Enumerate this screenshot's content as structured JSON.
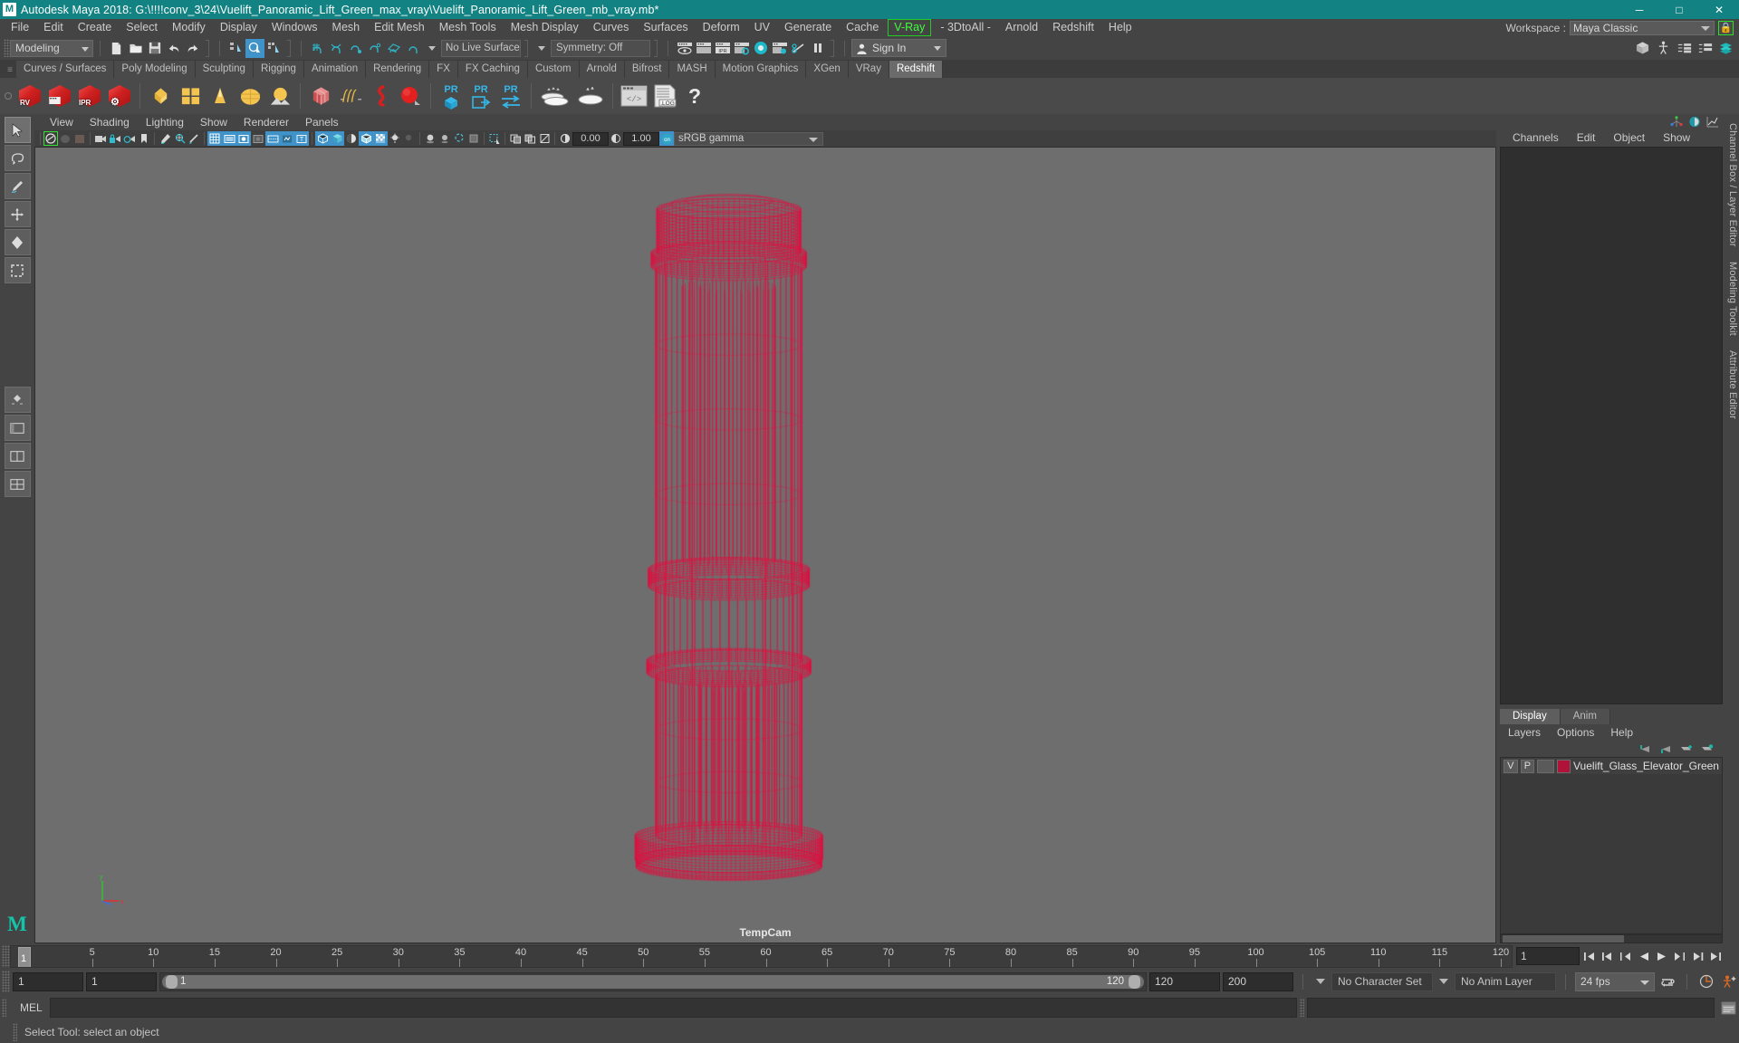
{
  "titlebar": {
    "logo": "M",
    "title": "Autodesk Maya 2018: G:\\!!!!conv_3\\24\\Vuelift_Panoramic_Lift_Green_max_vray\\Vuelift_Panoramic_Lift_Green_mb_vray.mb*",
    "minimize": "─",
    "maximize": "□",
    "close": "✕",
    "bg_color": "#128282"
  },
  "menubar": {
    "items": [
      {
        "label": "File"
      },
      {
        "label": "Edit"
      },
      {
        "label": "Create"
      },
      {
        "label": "Select"
      },
      {
        "label": "Modify"
      },
      {
        "label": "Display"
      },
      {
        "label": "Windows"
      },
      {
        "label": "Mesh"
      },
      {
        "label": "Edit Mesh"
      },
      {
        "label": "Mesh Tools"
      },
      {
        "label": "Mesh Display"
      },
      {
        "label": "Curves"
      },
      {
        "label": "Surfaces"
      },
      {
        "label": "Deform"
      },
      {
        "label": "UV"
      },
      {
        "label": "Generate"
      },
      {
        "label": "Cache"
      },
      {
        "label": "V-Ray",
        "highlight": true
      },
      {
        "label": "- 3DtoAll -"
      },
      {
        "label": "Arnold"
      },
      {
        "label": "Redshift"
      },
      {
        "label": "Help"
      }
    ],
    "workspace_label": "Workspace :",
    "workspace_value": "Maya Classic",
    "lock_icon": "lock-icon",
    "highlight_color": "#3dff3d"
  },
  "statusbar": {
    "mode_menu": "Modeling",
    "no_live_surface": "No Live Surface",
    "symmetry": "Symmetry: Off",
    "sign_in": "Sign In",
    "file_icons": [
      "new-scene-icon",
      "open-scene-icon",
      "save-scene-icon",
      "undo-icon",
      "redo-icon"
    ],
    "select_mode_icons": [
      "select-by-hierarchy-icon",
      "select-by-object-icon",
      "select-by-component-icon"
    ],
    "snap_icons": [
      "snap-to-grid-icon",
      "snap-to-curve-icon",
      "snap-to-point-icon",
      "snap-to-projected-center-icon",
      "snap-to-view-plane-icon",
      "make-live-icon"
    ],
    "render_icons": [
      "render-view-icon",
      "render-sequence-icon",
      "ipr-render-icon",
      "render-settings-icon",
      "hypershade-icon",
      "render-setup-icon",
      "rendering-flags-icon",
      "pause-icon"
    ],
    "right_icons": [
      "show-hide-modeling-toolkit-icon",
      "show-hide-character-controls-icon",
      "show-hide-attribute-editor-icon",
      "show-hide-tool-settings-icon",
      "show-hide-channel-box-icon"
    ]
  },
  "shelf": {
    "tabs": [
      {
        "label": "Curves / Surfaces"
      },
      {
        "label": "Poly Modeling"
      },
      {
        "label": "Sculpting"
      },
      {
        "label": "Rigging"
      },
      {
        "label": "Animation"
      },
      {
        "label": "Rendering"
      },
      {
        "label": "FX"
      },
      {
        "label": "FX Caching"
      },
      {
        "label": "Custom"
      },
      {
        "label": "Arnold"
      },
      {
        "label": "Bifrost"
      },
      {
        "label": "MASH"
      },
      {
        "label": "Motion Graphics"
      },
      {
        "label": "XGen"
      },
      {
        "label": "VRay"
      },
      {
        "label": "Redshift",
        "active": true
      }
    ],
    "buttons": [
      {
        "name": "redshift-render-view-icon",
        "badge": "RV"
      },
      {
        "name": "redshift-render-sequence-icon",
        "badge": ""
      },
      {
        "name": "redshift-ipr-icon",
        "badge": "IPR"
      },
      {
        "name": "redshift-render-settings-icon",
        "badge": ""
      },
      {
        "name": "redshift-material-icon",
        "badge": ""
      },
      {
        "name": "redshift-material-blender-icon",
        "badge": ""
      },
      {
        "name": "redshift-sss-icon",
        "badge": ""
      },
      {
        "name": "redshift-dome-light-icon",
        "badge": ""
      },
      {
        "name": "redshift-environment-icon",
        "badge": ""
      },
      {
        "name": "redshift-proxy-icon",
        "badge": ""
      },
      {
        "name": "redshift-hair-icon",
        "badge": ""
      },
      {
        "name": "redshift-volume-icon",
        "badge": ""
      },
      {
        "name": "redshift-sprite-icon",
        "badge": ""
      },
      {
        "name": "redshift-pr-object-icon",
        "badge": "PR"
      },
      {
        "name": "redshift-pr-export-icon",
        "badge": "PR"
      },
      {
        "name": "redshift-pr-transfer-icon",
        "badge": "PR"
      },
      {
        "name": "redshift-bake-icon",
        "badge": ""
      },
      {
        "name": "redshift-bake-set-icon",
        "badge": ""
      },
      {
        "name": "redshift-script-editor-icon",
        "badge": ""
      },
      {
        "name": "redshift-log-icon",
        "badge": ""
      },
      {
        "name": "redshift-help-icon",
        "badge": "?"
      }
    ]
  },
  "toolbox": {
    "items": [
      {
        "name": "select-tool",
        "glyph": "➤",
        "selected": true
      },
      {
        "name": "lasso-select-tool",
        "glyph": "❂"
      },
      {
        "name": "paint-select-tool",
        "glyph": "✎"
      },
      {
        "name": "move-tool",
        "glyph": "✥"
      },
      {
        "name": "rotate-tool",
        "glyph": "◆"
      },
      {
        "name": "scale-tool",
        "glyph": "▣"
      },
      {
        "name": "last-tool-used",
        "glyph": "◈"
      },
      {
        "name": "layout-single-pane",
        "glyph": "⊞"
      },
      {
        "name": "layout-two-pane",
        "glyph": "⬚"
      },
      {
        "name": "layout-four-pane",
        "glyph": "☷"
      }
    ],
    "logo": "M"
  },
  "viewport": {
    "menus": [
      {
        "label": "View"
      },
      {
        "label": "Shading"
      },
      {
        "label": "Lighting"
      },
      {
        "label": "Show"
      },
      {
        "label": "Renderer"
      },
      {
        "label": "Panels"
      }
    ],
    "exposure_value": "0.00",
    "gamma_value": "1.00",
    "color_profile": "sRGB gamma",
    "camera_label": "TempCam",
    "background_color": "#6e6e6e",
    "wireframe_color": "#e01040",
    "axis_labels": {
      "y": "y",
      "x": "x",
      "z": "z"
    },
    "toolbar_icons": [
      "select-camera-icon",
      "lock-camera-icon",
      "camera-attributes-icon",
      "bookmark-icon",
      "image-plane-icon",
      "two-d-pan-zoom-icon",
      "grease-pencil-icon",
      "grid-toggle-icon",
      "film-gate-icon",
      "resolution-gate-icon",
      "gate-mask-icon",
      "film-origin-icon",
      "safe-action-icon",
      "title-safe-icon",
      "wireframe-icon",
      "smooth-shade-all-icon",
      "shade-options-icon",
      "wireframe-on-shaded-icon",
      "texture-toggle-icon",
      "use-all-lights-icon",
      "shadows-icon",
      "screen-space-ambient-occlusion-icon",
      "motion-blur-icon",
      "multisample-icon",
      "isolate-select-icon",
      "xray-icon",
      "xray-joints-icon",
      "xray-active-components-icon",
      "exposure-icon",
      "gamma-icon",
      "view-transform-enabled-icon"
    ]
  },
  "channelbox": {
    "tabs": [
      "Channels",
      "Edit",
      "Object",
      "Show"
    ],
    "header_icons": [
      "channel-box-icon",
      "attribute-editor-icon",
      "graph-editor-icon"
    ],
    "side_tabs": [
      "Channel Box / Layer Editor",
      "Modeling Toolkit",
      "Attribute Editor"
    ]
  },
  "layer_editor": {
    "tabs": [
      {
        "label": "Display",
        "active": true
      },
      {
        "label": "Anim",
        "active": false
      }
    ],
    "menus": [
      {
        "label": "Layers"
      },
      {
        "label": "Options"
      },
      {
        "label": "Help"
      }
    ],
    "buttons": [
      "move-layer-up-icon",
      "move-layer-down-icon",
      "create-new-layer-icon",
      "create-layer-from-selected-icon"
    ],
    "layers": [
      {
        "visibility": "V",
        "playback": "P",
        "shading": "",
        "color": "#b0123a",
        "name": "Vuelift_Glass_Elevator_Green"
      }
    ]
  },
  "timeline": {
    "current_frame": "1",
    "ticks": [
      5,
      10,
      15,
      20,
      25,
      30,
      35,
      40,
      45,
      50,
      55,
      60,
      65,
      70,
      75,
      80,
      85,
      90,
      95,
      100,
      105,
      110,
      115,
      120
    ],
    "frame_field": "1",
    "playback_buttons": [
      "go-to-start-icon",
      "step-back-frame-icon",
      "step-back-key-icon",
      "play-backwards-icon",
      "play-forwards-icon",
      "step-forward-key-icon",
      "step-forward-frame-icon",
      "go-to-end-icon"
    ]
  },
  "range": {
    "anim_start": "1",
    "playback_start": "1",
    "range_start_label": "1",
    "range_end_label": "120",
    "playback_end": "120",
    "anim_end": "200",
    "character_set": "No Character Set",
    "anim_layer": "No Anim Layer",
    "fps": "24 fps",
    "right_icons": [
      "auto-key-icon",
      "animation-preferences-icon"
    ],
    "loop_icon": "playback-loop-icon"
  },
  "command_line": {
    "language": "MEL",
    "input_value": "",
    "output_value": ""
  },
  "helpline": {
    "text": "Select Tool: select an object"
  }
}
